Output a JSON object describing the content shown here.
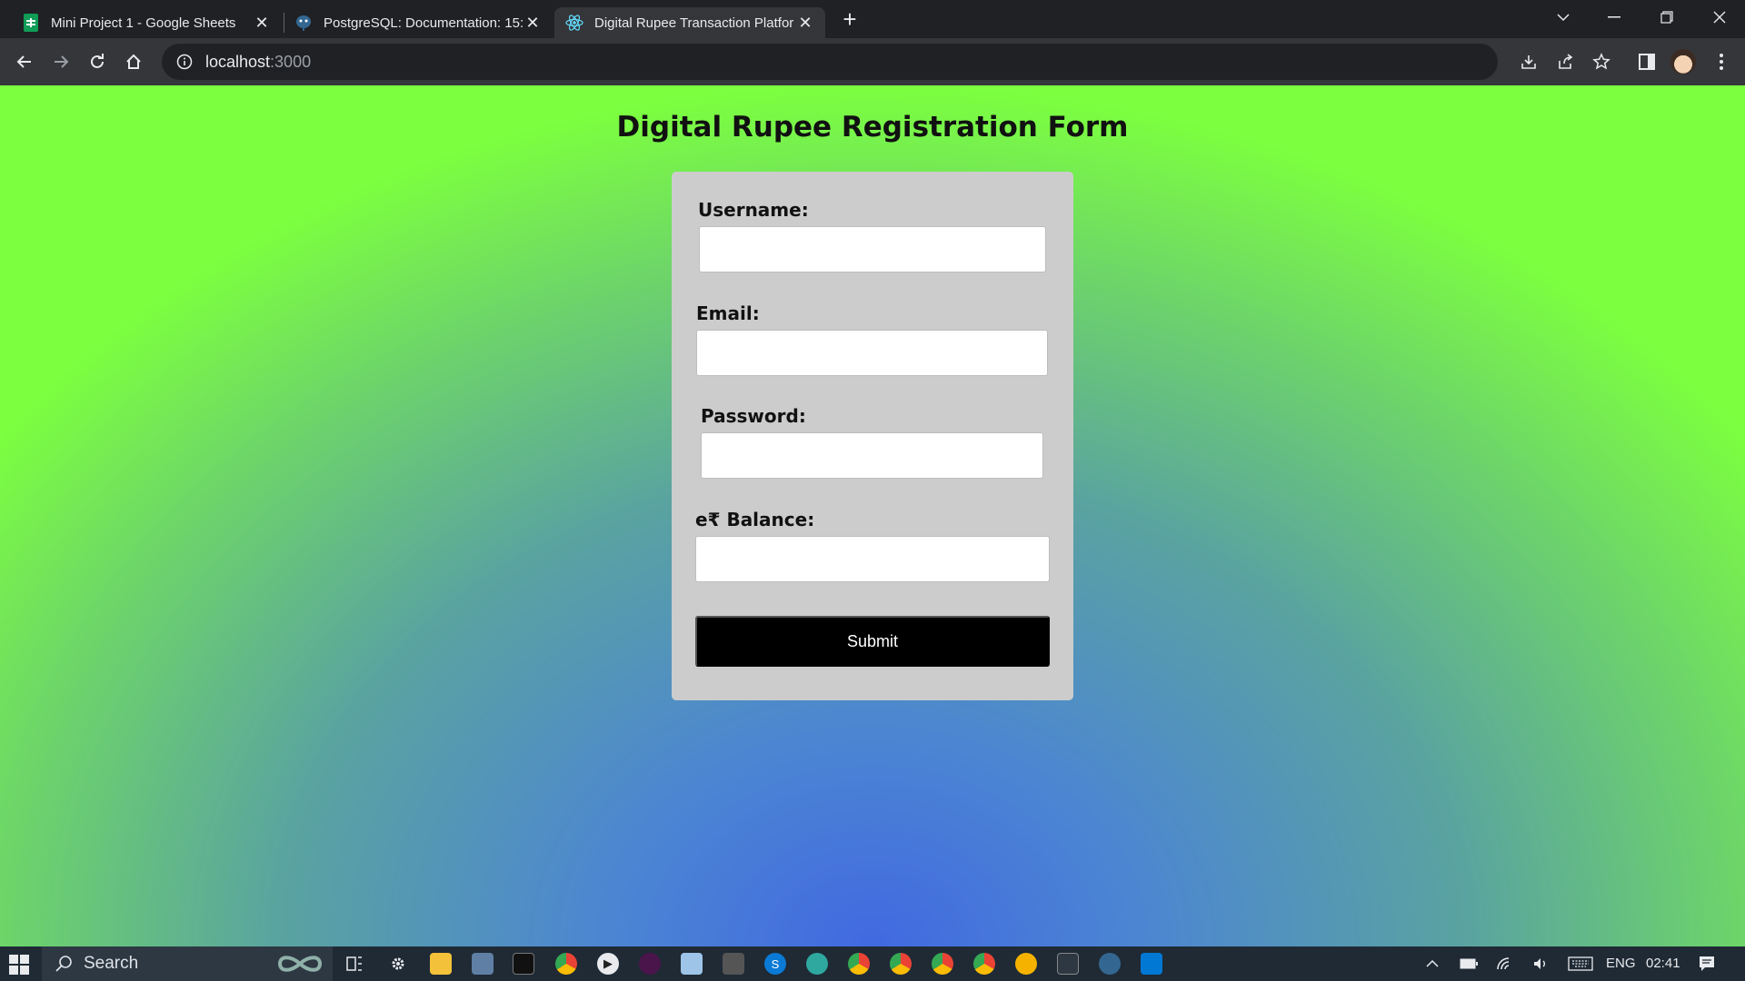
{
  "browser": {
    "tabs": [
      {
        "title": "Mini Project 1 - Google Sheets",
        "icon": "google-sheets-icon",
        "active": false
      },
      {
        "title": "PostgreSQL: Documentation: 15:",
        "icon": "postgresql-icon",
        "active": false
      },
      {
        "title": "Digital Rupee Transaction Platfor",
        "icon": "react-icon",
        "active": true
      }
    ],
    "url_host": "localhost",
    "url_port": ":3000"
  },
  "page": {
    "title": "Digital Rupee Registration Form",
    "fields": {
      "username_label": "Username:",
      "email_label": "Email:",
      "password_label": "Password:",
      "balance_label": "e₹ Balance:"
    },
    "submit_label": "Submit"
  },
  "taskbar": {
    "search_placeholder": "Search",
    "language": "ENG",
    "time": "02:41"
  },
  "colors": {
    "gradient_center": "#4169e1",
    "gradient_edge": "#7cff3f",
    "card_bg": "#cccccc",
    "button_bg": "#000000"
  }
}
